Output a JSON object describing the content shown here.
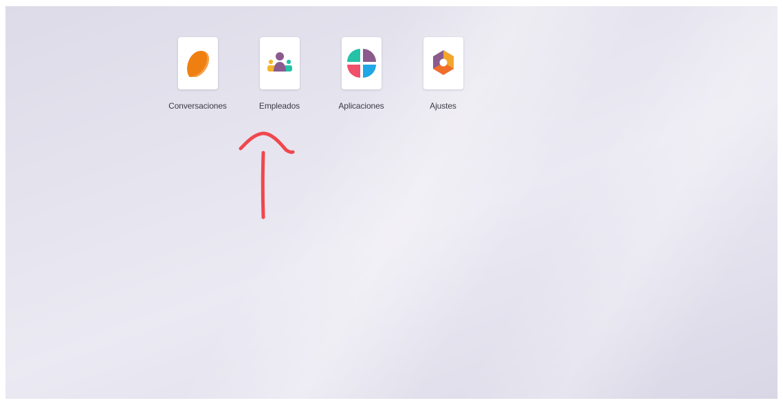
{
  "apps": [
    {
      "label": "Conversaciones",
      "icon": "conversations-icon"
    },
    {
      "label": "Empleados",
      "icon": "employees-icon"
    },
    {
      "label": "Aplicaciones",
      "icon": "apps-icon"
    },
    {
      "label": "Ajustes",
      "icon": "settings-icon"
    }
  ],
  "colors": {
    "annotation": "#f0474e",
    "conversations_orange": "#f28a1e",
    "purple": "#8a5a8c",
    "teal": "#25c2a8",
    "red": "#f0506a",
    "blue": "#1fa7e6",
    "yellow": "#f3b52c"
  }
}
